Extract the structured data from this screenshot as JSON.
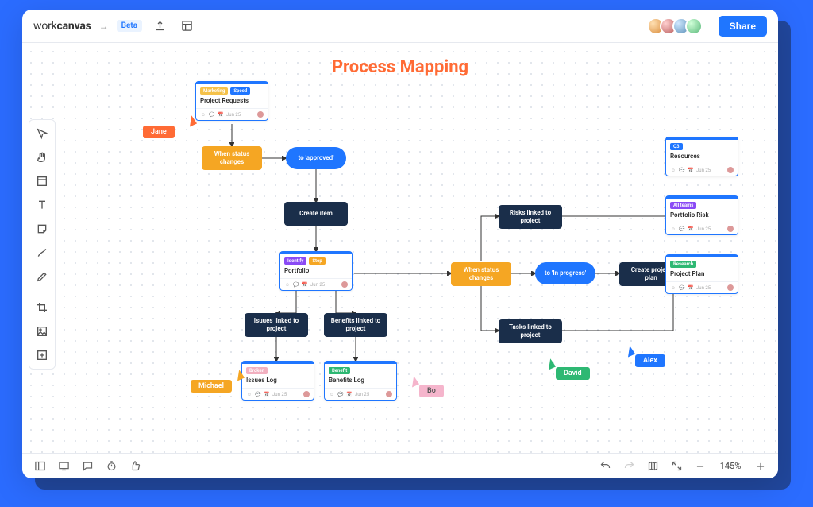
{
  "header": {
    "logo_prefix": "work",
    "logo_bold": "canvas",
    "beta_label": "Beta",
    "share_label": "Share"
  },
  "avatars": [
    {
      "bg": "radial-gradient(circle at 30% 30%, #ffe0b3, #d98b3a)"
    },
    {
      "bg": "radial-gradient(circle at 30% 30%, #ffd0d0, #b85a5a)"
    },
    {
      "bg": "radial-gradient(circle at 30% 30%, #d0e8ff, #5a8fb8)"
    },
    {
      "bg": "radial-gradient(circle at 30% 30%, #d0ffd8, #5ab87a)"
    }
  ],
  "canvas": {
    "title": "Process Mapping",
    "zoom": "145%"
  },
  "users": [
    {
      "name": "Jane",
      "color": "#ff6b35"
    },
    {
      "name": "Michael",
      "color": "#f5a623"
    },
    {
      "name": "Bo",
      "color": "#f5b5cc"
    },
    {
      "name": "David",
      "color": "#2eb873"
    },
    {
      "name": "Alex",
      "color": "#1f76ff"
    }
  ],
  "cards": {
    "project_requests": {
      "chips": [
        {
          "label": "Marketing",
          "color": "#f5c24a"
        },
        {
          "label": "Speed",
          "color": "#1f76ff"
        }
      ],
      "title": "Project Requests",
      "date": "Jun 25"
    },
    "portfolio": {
      "chips": [
        {
          "label": "Identify",
          "color": "#8a4af5"
        },
        {
          "label": "Stop",
          "color": "#f5a623"
        }
      ],
      "title": "Portfolio",
      "date": "Jun 25"
    },
    "issues_log": {
      "chips": [
        {
          "label": "Broken",
          "color": "#f2b0c0"
        }
      ],
      "title": "Issues Log",
      "date": "Jun 25"
    },
    "benefits_log": {
      "chips": [
        {
          "label": "Benefit",
          "color": "#2eb873"
        }
      ],
      "title": "Benefits Log",
      "date": "Jun 25"
    },
    "resources": {
      "chips": [
        {
          "label": "Q3",
          "color": "#1f76ff"
        }
      ],
      "title": "Resources",
      "date": "Jun 25"
    },
    "portfolio_risk": {
      "chips": [
        {
          "label": "All teams",
          "color": "#8a4af5"
        }
      ],
      "title": "Portfolio Risk",
      "date": "Jun 25"
    },
    "project_plan": {
      "chips": [
        {
          "label": "Research",
          "color": "#2eb873"
        }
      ],
      "title": "Project Plan",
      "date": "Jun 25"
    }
  },
  "pills": {
    "when_status_1": "When status changes",
    "to_approved": "to 'approved'",
    "create_item": "Create item",
    "when_status_2": "When status changes",
    "to_in_progress": "to 'In progress'",
    "create_plan": "Create project plan",
    "risks_linked": "Risks linked to project",
    "tasks_linked": "Tasks linked to project",
    "issues_linked": "Isuues linked to project",
    "benefits_linked": "Benefits linked to project"
  }
}
